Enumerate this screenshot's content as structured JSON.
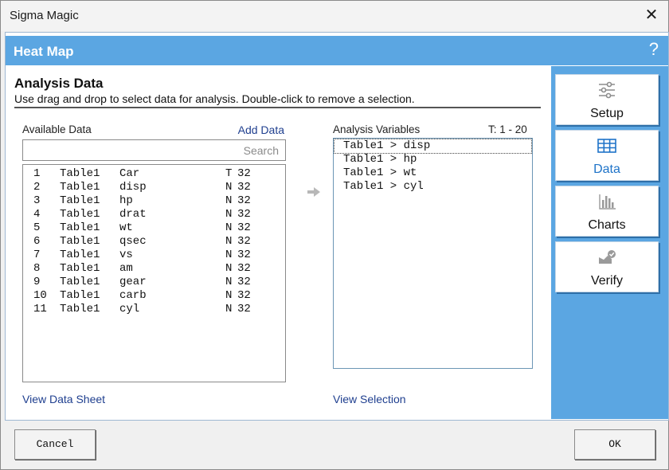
{
  "window": {
    "title": "Sigma Magic",
    "close_glyph": "✕"
  },
  "header": {
    "title": "Heat Map",
    "help_glyph": "?"
  },
  "section": {
    "title": "Analysis Data",
    "description": "Use drag and drop to select data for analysis. Double-click to remove a selection."
  },
  "available": {
    "label": "Available Data",
    "add_link": "Add Data",
    "search_placeholder": "Search",
    "view_link": "View Data Sheet",
    "rows": [
      {
        "num": "1",
        "table": "Table1",
        "name": "Car",
        "type": "T",
        "count": "32"
      },
      {
        "num": "2",
        "table": "Table1",
        "name": "disp",
        "type": "N",
        "count": "32"
      },
      {
        "num": "3",
        "table": "Table1",
        "name": "hp",
        "type": "N",
        "count": "32"
      },
      {
        "num": "4",
        "table": "Table1",
        "name": "drat",
        "type": "N",
        "count": "32"
      },
      {
        "num": "5",
        "table": "Table1",
        "name": "wt",
        "type": "N",
        "count": "32"
      },
      {
        "num": "6",
        "table": "Table1",
        "name": "qsec",
        "type": "N",
        "count": "32"
      },
      {
        "num": "7",
        "table": "Table1",
        "name": "vs",
        "type": "N",
        "count": "32"
      },
      {
        "num": "8",
        "table": "Table1",
        "name": "am",
        "type": "N",
        "count": "32"
      },
      {
        "num": "9",
        "table": "Table1",
        "name": "gear",
        "type": "N",
        "count": "32"
      },
      {
        "num": "10",
        "table": "Table1",
        "name": "carb",
        "type": "N",
        "count": "32"
      },
      {
        "num": "11",
        "table": "Table1",
        "name": "cyl",
        "type": "N",
        "count": "32"
      }
    ]
  },
  "analysis": {
    "label": "Analysis Variables",
    "range": "T: 1 - 20",
    "view_link": "View Selection",
    "rows": [
      "Table1 > disp",
      "Table1 > hp",
      "Table1 > wt",
      "Table1 > cyl"
    ]
  },
  "sidebar": {
    "items": [
      {
        "label": "Setup",
        "icon": "sliders-icon",
        "active": false
      },
      {
        "label": "Data",
        "icon": "table-grid-icon",
        "active": true
      },
      {
        "label": "Charts",
        "icon": "bar-chart-icon",
        "active": false
      },
      {
        "label": "Verify",
        "icon": "verify-check-icon",
        "active": false
      }
    ]
  },
  "footer": {
    "cancel_label": "Cancel",
    "ok_label": "OK"
  },
  "colors": {
    "accent": "#5ba6e2",
    "link": "#1f3f8f",
    "active": "#1e73c8"
  }
}
